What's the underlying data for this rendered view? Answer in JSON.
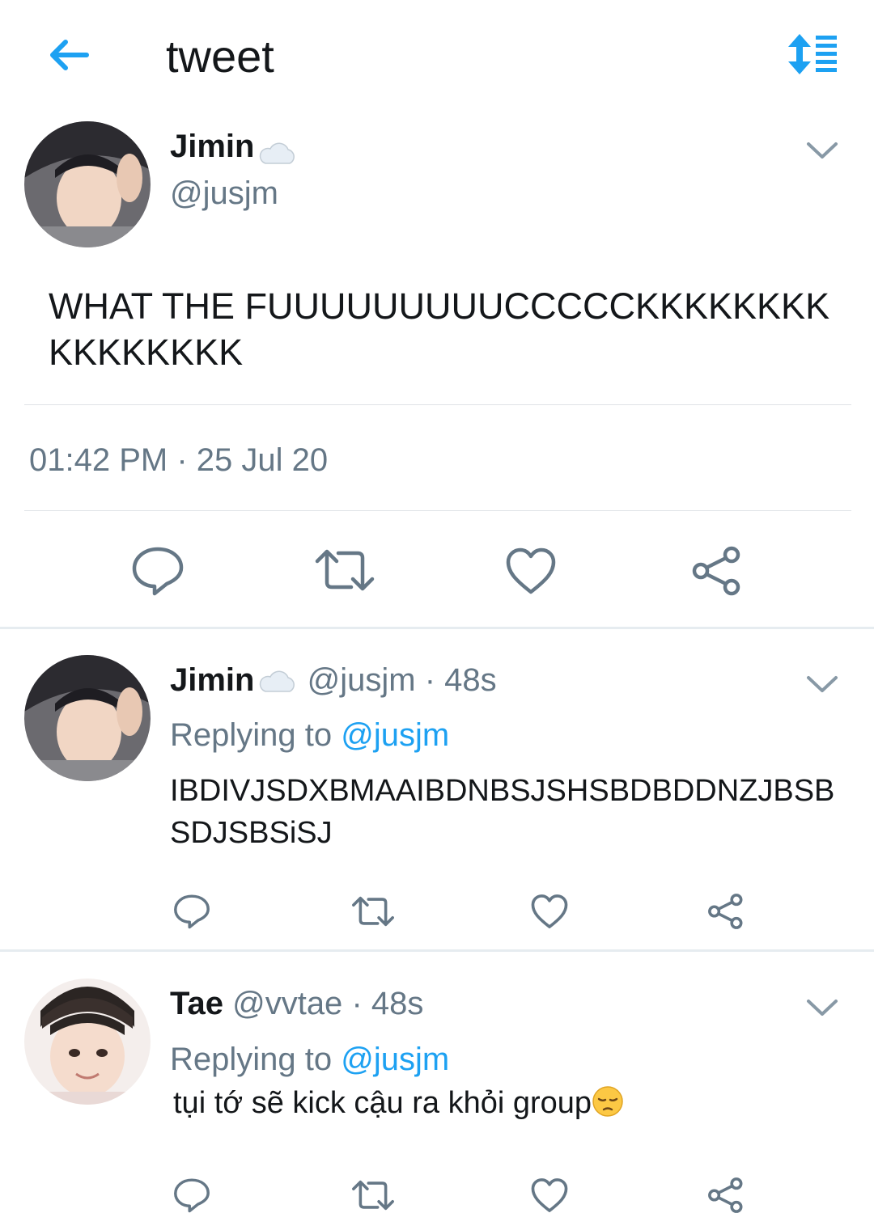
{
  "header": {
    "title": "tweet",
    "back_icon": "arrow-left-icon",
    "sort_icon": "sort-list-icon"
  },
  "main_tweet": {
    "name": "Jimin",
    "name_emoji": "cloud-icon",
    "handle": "@jusjm",
    "text": "WHAT THE FUUUUUUUUUCCCCCKKKKKKKKKKKKKKKK",
    "time": "01:42 PM",
    "separator": "·",
    "date": "25 Jul 20"
  },
  "replies": [
    {
      "name": "Jimin",
      "handle": "@jusjm",
      "separator": "·",
      "age": "48s",
      "replying_prefix": "Replying to",
      "replying_handle": "@jusjm",
      "text": "IBDIVJSDXBMAAIBDNBSJSHSBDBDDNZJBSBSDJSBSiSJ"
    },
    {
      "name": "Tae",
      "handle": "@vvtae",
      "separator": "·",
      "age": "48s",
      "replying_prefix": "Replying to",
      "replying_handle": "@jusjm",
      "text": "tụi tớ sẽ kick cậu ra khỏi group",
      "emoji": "pensive-face-emoji"
    }
  ],
  "colors": {
    "accent": "#1da1f2",
    "secondary_text": "#657786",
    "icon": "#657786"
  }
}
